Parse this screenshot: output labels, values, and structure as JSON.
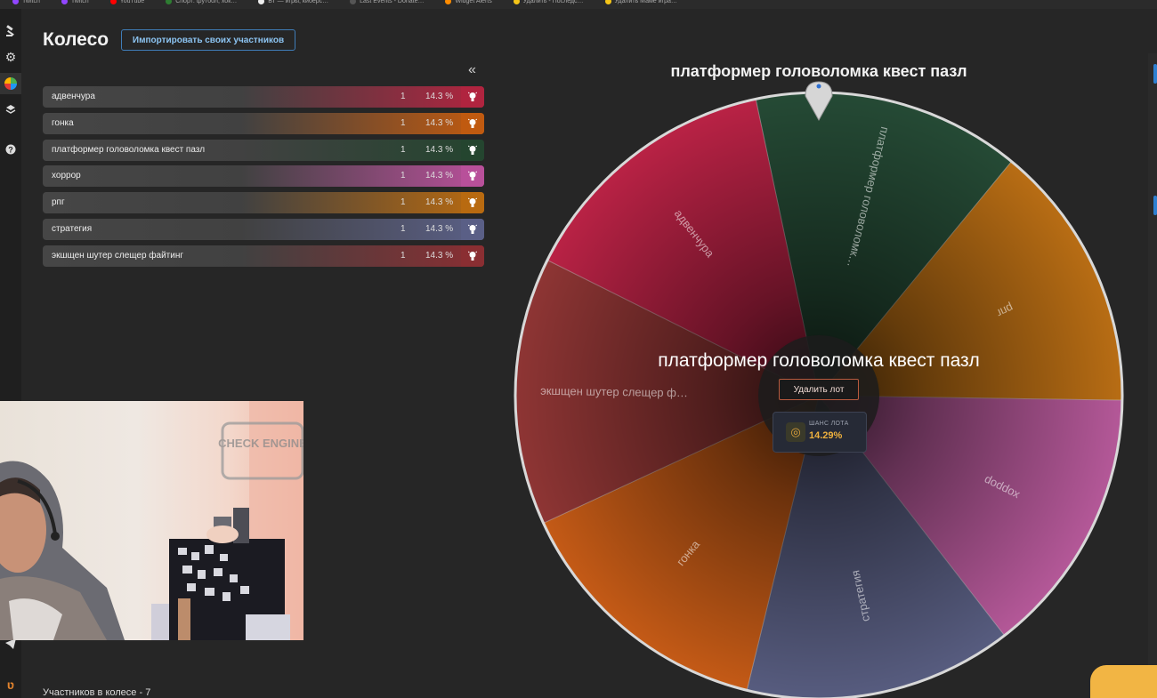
{
  "bookmarks": [
    "Twitch",
    "Twitch",
    "YouTube",
    "Спорт: футбол, хок…",
    "ВТ — игры, киберс…",
    "Last Events - Donate…",
    "Widget Alerts",
    "Удалить - Последс…",
    "Удалить Маме игра…"
  ],
  "header": {
    "title": "Колесо",
    "import_label": "Импортировать своих участников"
  },
  "collapse_glyph": "«",
  "participants": [
    {
      "name": "адвенчура",
      "count": "1",
      "percent": "14.3 %",
      "color": "#b0243f"
    },
    {
      "name": "гонка",
      "count": "1",
      "percent": "14.3 %",
      "color": "#c05a10"
    },
    {
      "name": "платформер головоломка квест пазл",
      "count": "1",
      "percent": "14.3 %",
      "color": "#24452f"
    },
    {
      "name": "хоррор",
      "count": "1",
      "percent": "14.3 %",
      "color": "#b8509a"
    },
    {
      "name": "рпг",
      "count": "1",
      "percent": "14.3 %",
      "color": "#b86a10"
    },
    {
      "name": "стратегия",
      "count": "1",
      "percent": "14.3 %",
      "color": "#5a5f86"
    },
    {
      "name": "экшщен шутер слещер файтинг",
      "count": "1",
      "percent": "14.3 %",
      "color": "#8a2e32"
    }
  ],
  "wheel": {
    "winner_title": "платформер головоломка квест пазл",
    "center_text": "платформер головоломка квест пазл",
    "delete_label": "Удалить лот",
    "chance_label": "ШАНС ЛОТА",
    "chance_value": "14.29%",
    "segments": [
      {
        "label": "платформер головоломк…",
        "color": "#254a35"
      },
      {
        "label": "рпг",
        "color": "#b86d14"
      },
      {
        "label": "хоррор",
        "color": "#b45898"
      },
      {
        "label": "стратегия",
        "color": "#575c7f"
      },
      {
        "label": "гонка",
        "color": "#c45a16"
      },
      {
        "label": "экшщен шутер слещер ф…",
        "color": "#8e3534"
      },
      {
        "label": "адвенчура",
        "color": "#b92245"
      }
    ]
  },
  "footer": {
    "participants_count": "Участников в колесе - 7"
  },
  "webcam": {
    "sign_text": "CHECK ENGINE"
  }
}
